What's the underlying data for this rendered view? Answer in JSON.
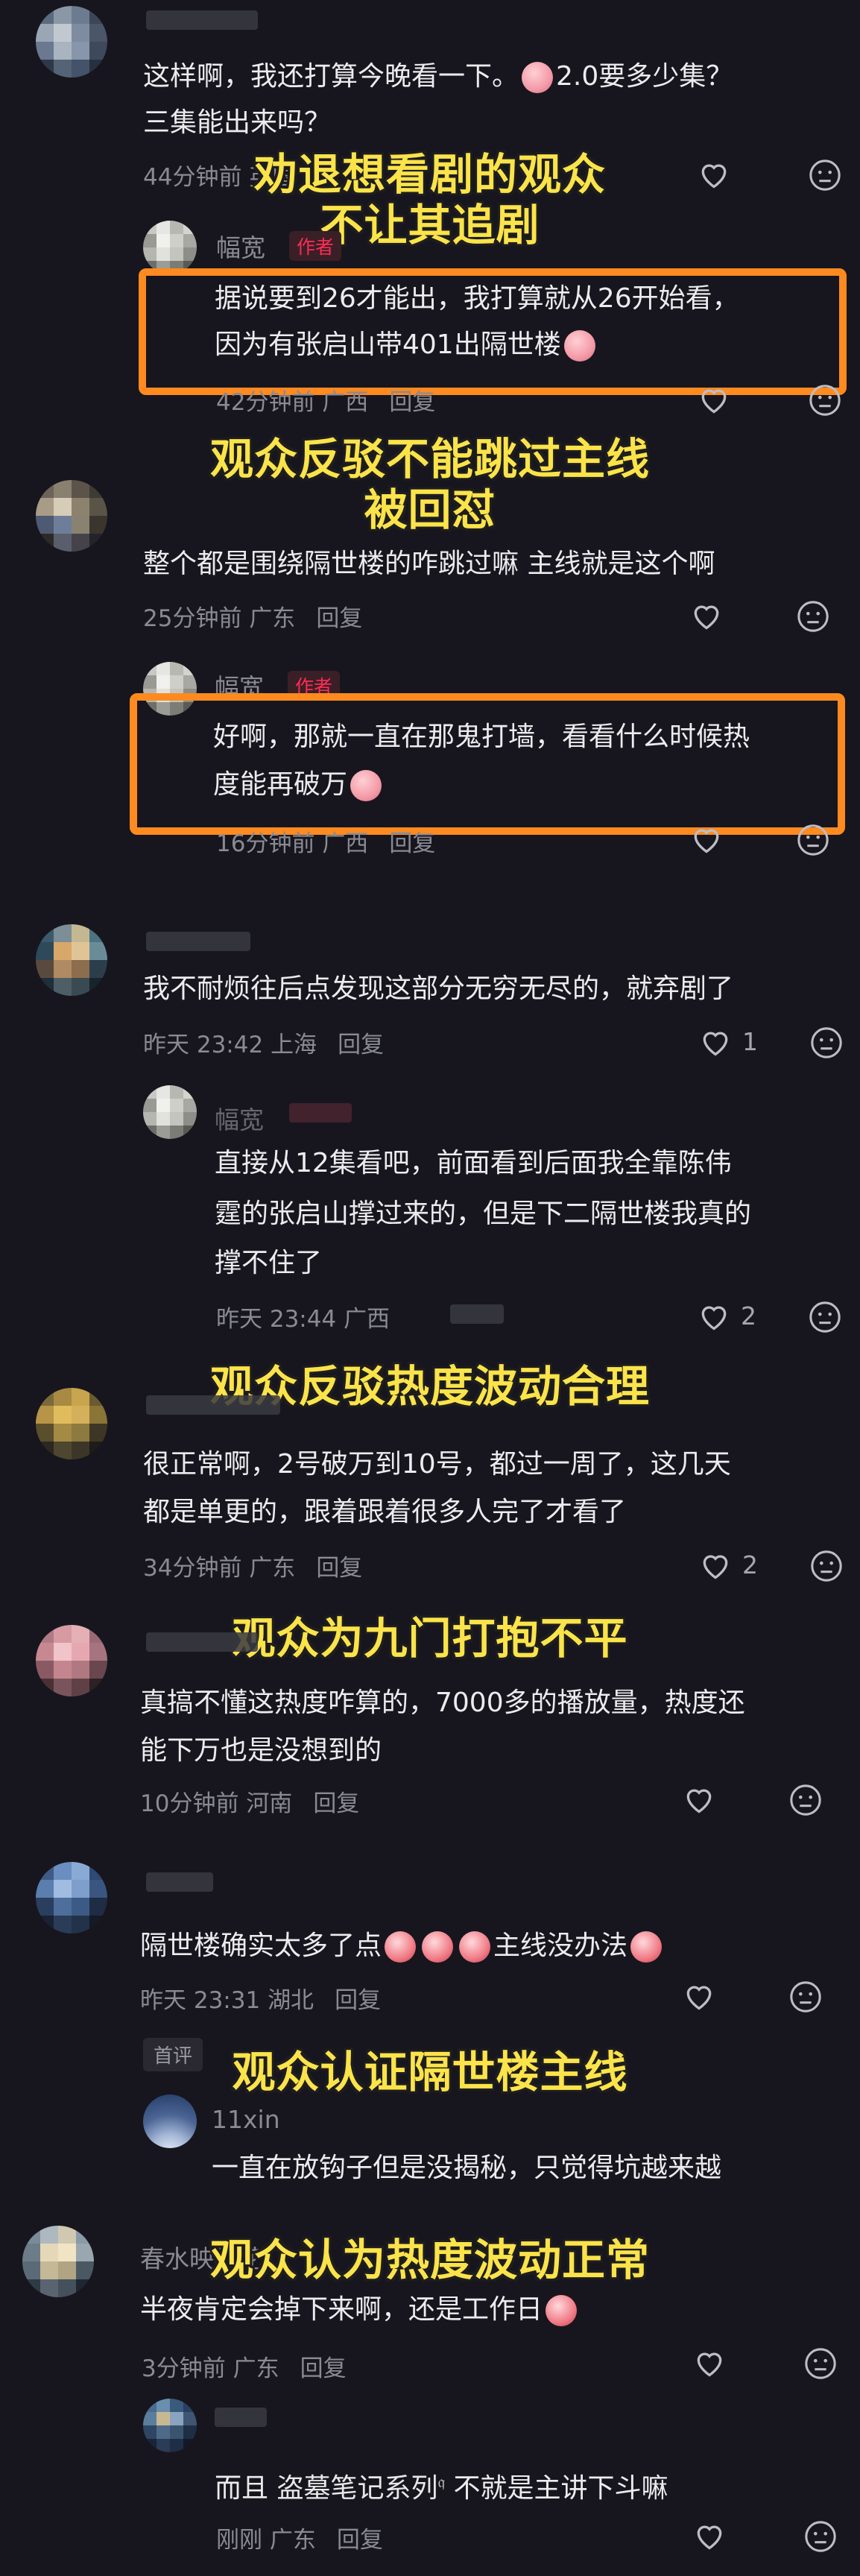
{
  "captions": [
    "劝退想看剧的观众",
    "不让其追剧",
    "观众反驳不能跳过主线",
    "被回怼",
    "观众反驳热度波动合理",
    "观众为九门打抱不平",
    "观众认证隔世楼主线",
    "观众认为热度波动正常"
  ],
  "comments": [
    {
      "line1": "这样啊，我还打算今晚看一下。",
      "line1b": "2.0要多少集？",
      "line2": "三集能出来吗？",
      "time": "44分钟前",
      "loc": "英国",
      "reply": ""
    },
    {
      "author": "幅宽",
      "badge": "作者",
      "line1": "据说要到26才能出，我打算就从26开始看，",
      "line2": "因为有张启山带401出隔世楼",
      "time": "42分钟前",
      "loc": "广西",
      "reply": "回复"
    },
    {
      "line1": "整个都是围绕隔世楼的咋跳过嘛  主线就是这个啊",
      "time": "25分钟前",
      "loc": "广东",
      "reply": "回复"
    },
    {
      "author": "幅宽",
      "badge": "作者",
      "line1": "好啊，那就一直在那鬼打墙，看看什么时候热",
      "line2": "度能再破万",
      "time": "16分钟前",
      "loc": "广西",
      "reply": "回复"
    },
    {
      "line1": "我不耐烦往后点发现这部分无穷无尽的，就弃剧了",
      "time": "昨天 23:42",
      "loc": "上海",
      "reply": "回复",
      "likes": "1"
    },
    {
      "author": "幅宽",
      "line1": "直接从12集看吧，前面看到后面我全靠陈伟",
      "line2": "霆的张启山撑过来的，但是下二隔世楼我真的",
      "line3": "撑不住了",
      "time": "昨天 23:44",
      "loc": "广西",
      "likes": "2"
    },
    {
      "line1": "很正常啊，2号破万到10号，都过一周了，这几天",
      "line2": "都是单更的，跟着跟着很多人完了才看了",
      "time": "34分钟前",
      "loc": "广东",
      "reply": "回复",
      "likes": "2"
    },
    {
      "line1": "真搞不懂这热度咋算的，7000多的播放量，热度还",
      "line2": "能下万也是没想到的",
      "time": "10分钟前",
      "loc": "河南",
      "reply": "回复"
    },
    {
      "line1a": "隔世楼确实太多了点",
      "line1b": "主线没办法",
      "time": "昨天 23:31",
      "loc": "湖北",
      "reply": "回复"
    },
    {
      "first": "首评",
      "author": "11xin",
      "line1": "一直在放钩子但是没揭秘，只觉得坑越来越"
    },
    {
      "author": "春水映梨花",
      "line1": "半夜肯定会掉下来啊，还是工作日",
      "time": "3分钟前",
      "loc": "广东",
      "reply": "回复"
    },
    {
      "line1a": "而且",
      "line1link": "盗墓笔记系列",
      "line1b": "不就是主讲下斗嘛",
      "time": "刚刚",
      "loc": "广东",
      "reply": "回复"
    }
  ],
  "colors": {
    "caption": "#fbe34a",
    "highlight": "#ff8a1f",
    "badge": "#fe2c55",
    "bg": "#17161e"
  }
}
